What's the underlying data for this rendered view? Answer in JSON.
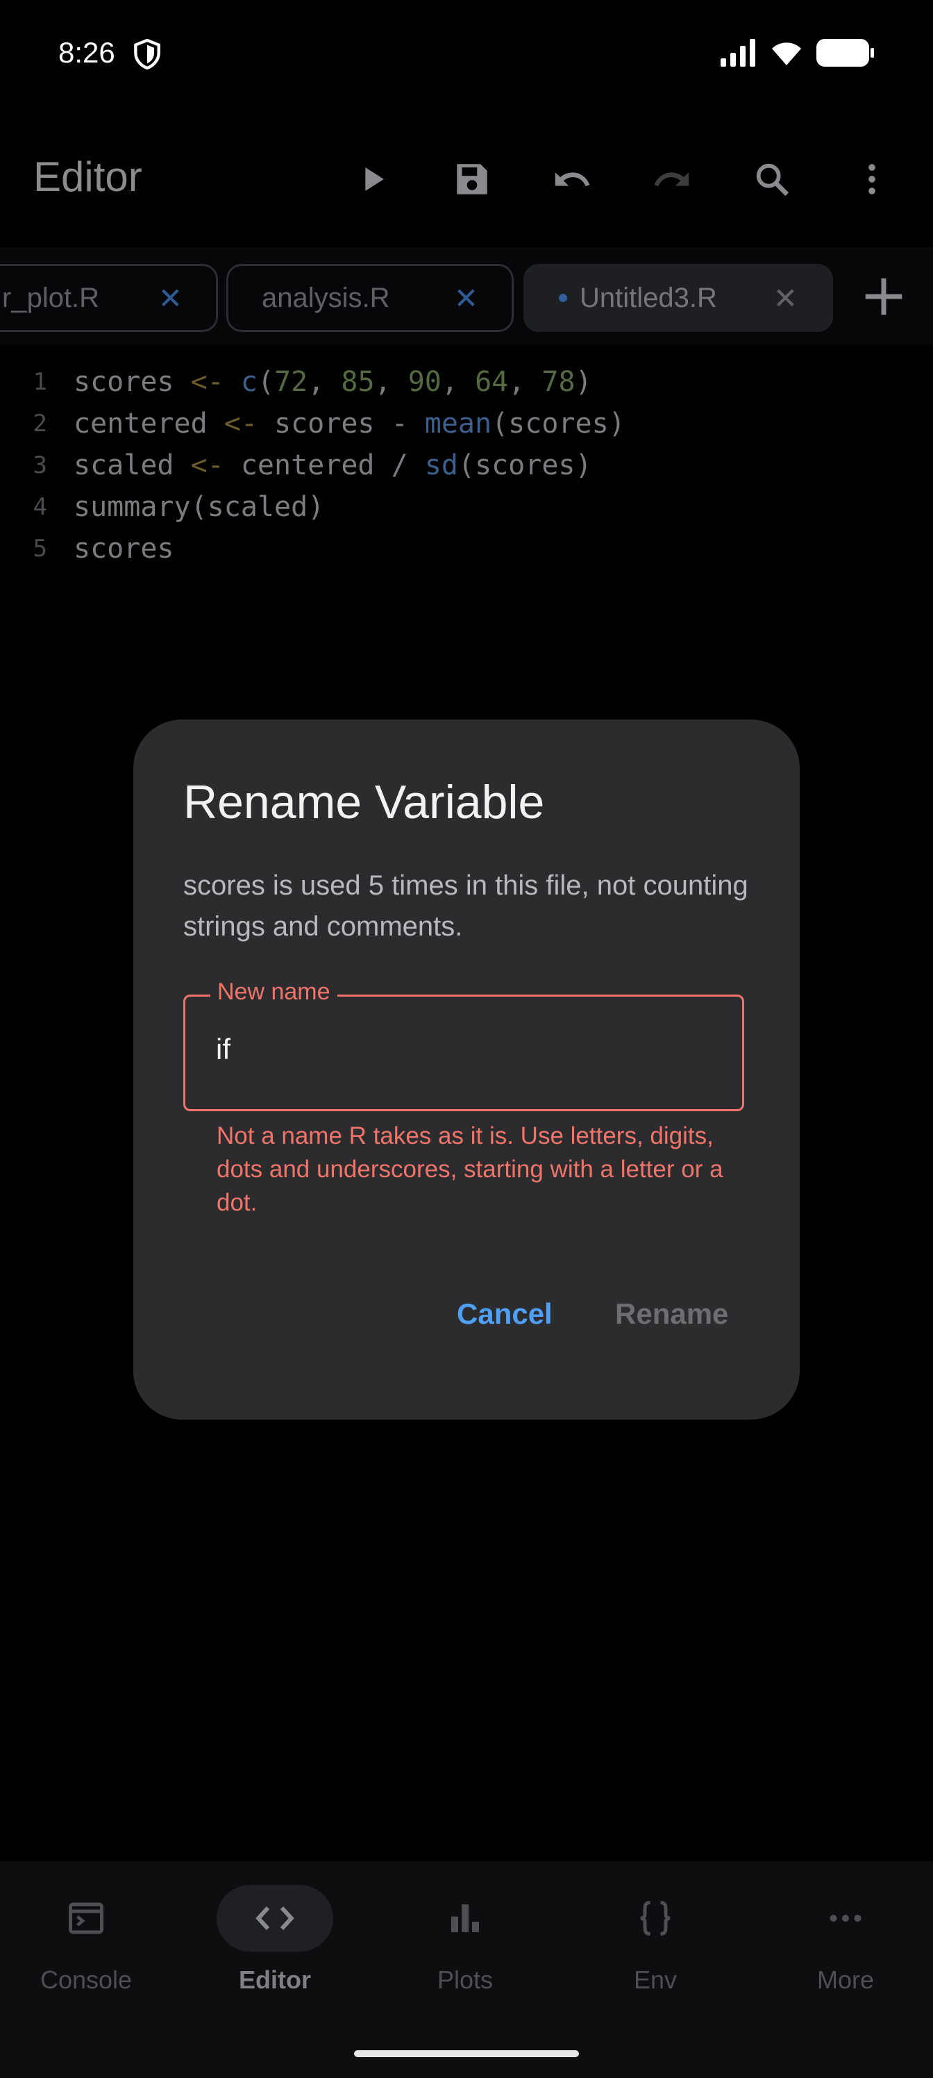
{
  "status_bar": {
    "time": "8:26"
  },
  "app_bar": {
    "title": "Editor"
  },
  "tabs": [
    {
      "label": "r_plot.R",
      "close": "✕"
    },
    {
      "label": "analysis.R",
      "close": "✕"
    },
    {
      "label": "Untitled3.R",
      "close": "✕",
      "modified": true
    }
  ],
  "editor": {
    "line_numbers": [
      "1",
      "2",
      "3",
      "4",
      "5"
    ],
    "lines": [
      [
        {
          "t": "scores ",
          "c": "tx"
        },
        {
          "t": "<-",
          "c": "op"
        },
        {
          "t": " ",
          "c": "tx"
        },
        {
          "t": "c",
          "c": "fn"
        },
        {
          "t": "(",
          "c": "tx"
        },
        {
          "t": "72",
          "c": "num"
        },
        {
          "t": ", ",
          "c": "tx"
        },
        {
          "t": "85",
          "c": "num"
        },
        {
          "t": ", ",
          "c": "tx"
        },
        {
          "t": "90",
          "c": "num"
        },
        {
          "t": ", ",
          "c": "tx"
        },
        {
          "t": "64",
          "c": "num"
        },
        {
          "t": ", ",
          "c": "tx"
        },
        {
          "t": "78",
          "c": "num"
        },
        {
          "t": ")",
          "c": "tx"
        }
      ],
      [
        {
          "t": "centered ",
          "c": "tx"
        },
        {
          "t": "<-",
          "c": "op"
        },
        {
          "t": " scores - ",
          "c": "tx"
        },
        {
          "t": "mean",
          "c": "fn"
        },
        {
          "t": "(scores)",
          "c": "tx"
        }
      ],
      [
        {
          "t": "scaled ",
          "c": "tx"
        },
        {
          "t": "<-",
          "c": "op"
        },
        {
          "t": " centered / ",
          "c": "tx"
        },
        {
          "t": "sd",
          "c": "fn"
        },
        {
          "t": "(scores)",
          "c": "tx"
        }
      ],
      [
        {
          "t": "summary(scaled)",
          "c": "tx"
        }
      ],
      [
        {
          "t": "scores",
          "c": "tx"
        }
      ]
    ]
  },
  "dialog": {
    "title": "Rename Variable",
    "message": "scores is used 5 times in this file, not counting strings and comments.",
    "field_label": "New name",
    "field_value": "if",
    "error": "Not a name R takes as it is. Use letters, digits, dots and underscores, starting with a letter or a dot.",
    "cancel_label": "Cancel",
    "confirm_label": "Rename"
  },
  "bottom_nav": [
    {
      "label": "Console",
      "icon": "console-icon",
      "active": false
    },
    {
      "label": "Editor",
      "icon": "code-icon",
      "active": true
    },
    {
      "label": "Plots",
      "icon": "bar-chart-icon",
      "active": false
    },
    {
      "label": "Env",
      "icon": "braces-icon",
      "active": false
    },
    {
      "label": "More",
      "icon": "more-horizontal-icon",
      "active": false
    }
  ],
  "colors": {
    "error": "#f07469",
    "accent": "#4e9ff5",
    "dialog_bg": "#2c2c2e"
  }
}
